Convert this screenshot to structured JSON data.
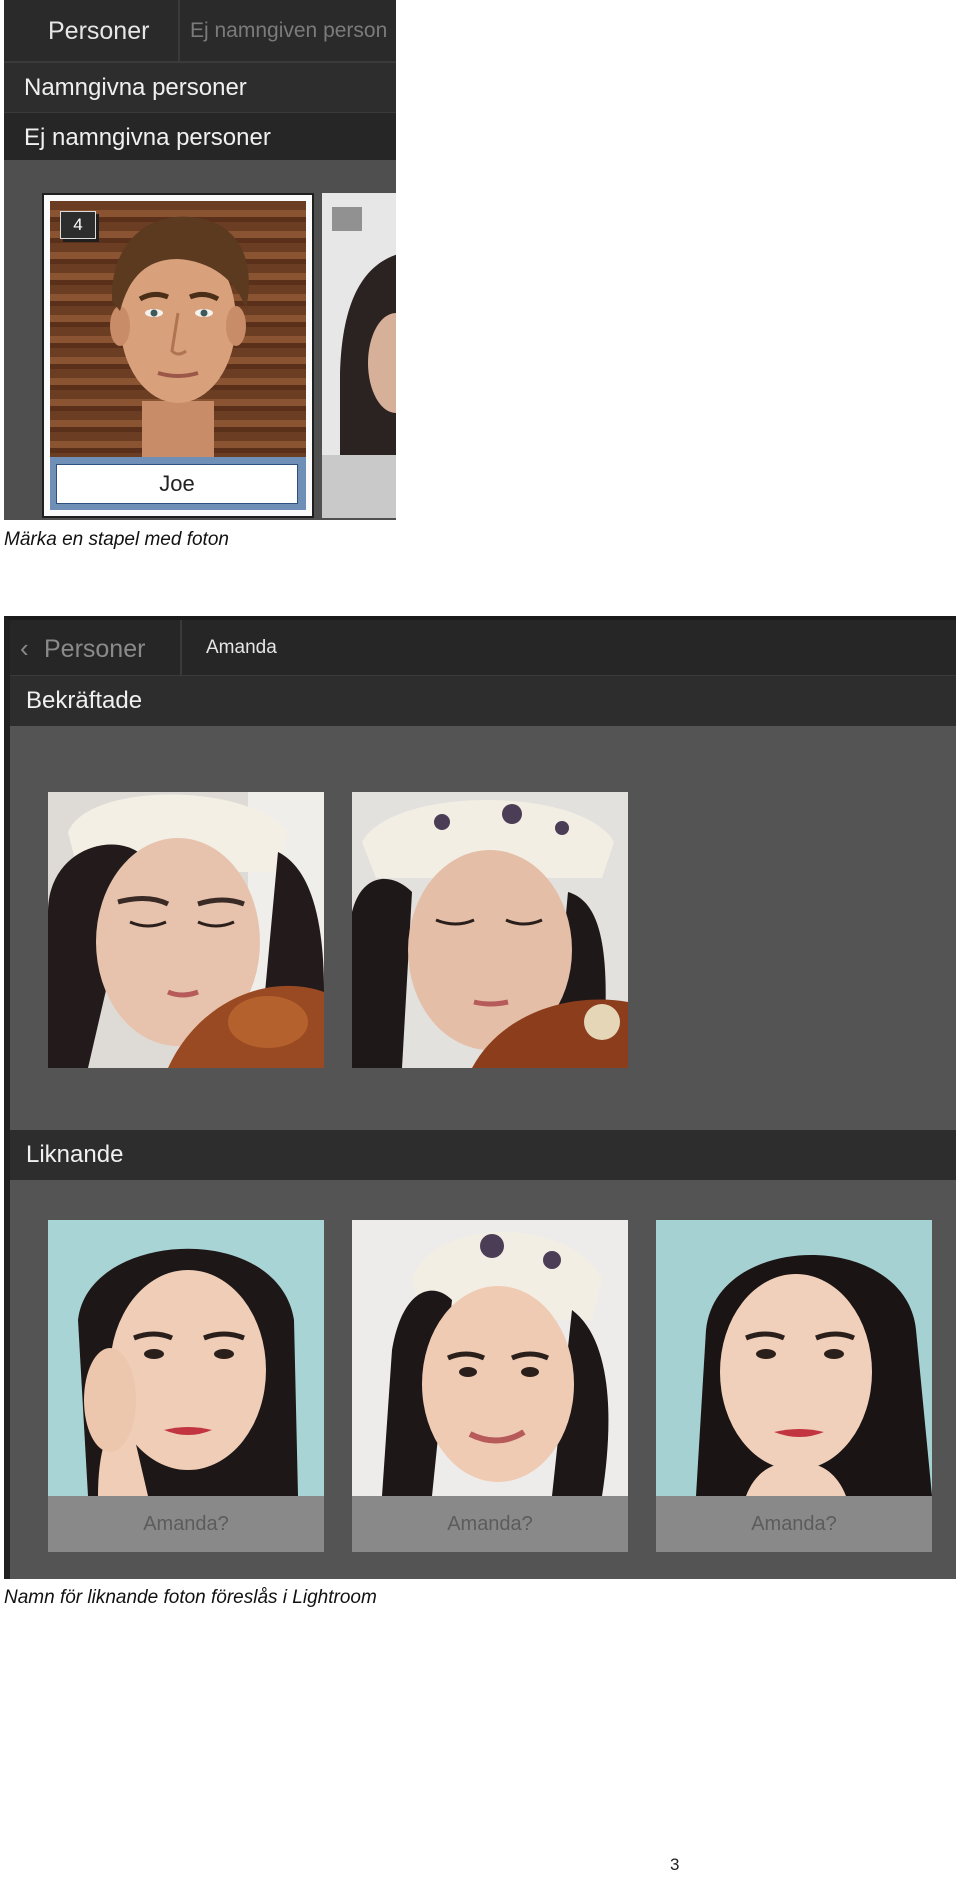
{
  "screenshot1": {
    "tabs": {
      "active": "Personer",
      "inactive": "Ej namngiven person"
    },
    "sections": {
      "named": "Namngivna personer",
      "unnamed": "Ej namngivna personer"
    },
    "stack": {
      "count": "4",
      "name_value": "Joe"
    }
  },
  "caption1": "Märka en stapel med foton",
  "screenshot2": {
    "back_label": "Personer",
    "breadcrumb": "Amanda",
    "confirmed_header": "Bekräftade",
    "similar_header": "Liknande",
    "suggestions": [
      "Amanda?",
      "Amanda?",
      "Amanda?"
    ]
  },
  "caption2": "Namn för liknande foton föreslås i Lightroom",
  "page_number": "3",
  "icons": [
    "chevron-left-icon"
  ]
}
